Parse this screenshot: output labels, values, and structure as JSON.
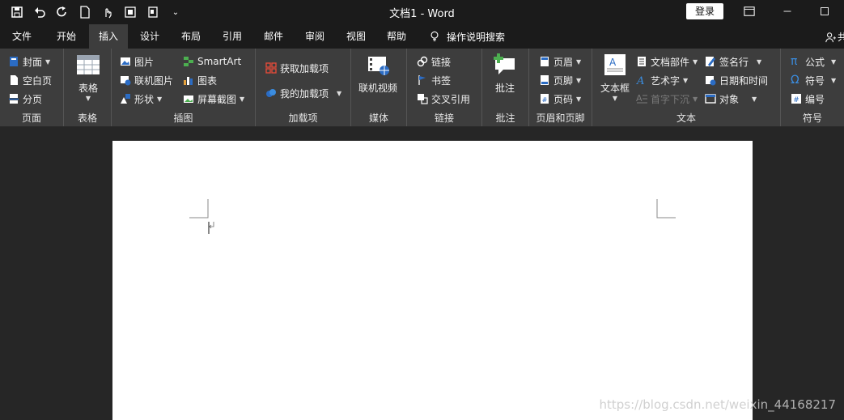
{
  "window": {
    "title": "文档1  -  Word",
    "login_label": "登录"
  },
  "tabs": [
    "文件",
    "开始",
    "插入",
    "设计",
    "布局",
    "引用",
    "邮件",
    "审阅",
    "视图",
    "帮助"
  ],
  "tell_me": "操作说明搜索",
  "user_glyph": "共",
  "ribbon": {
    "page": {
      "label": "页面",
      "items": [
        "封面",
        "空白页",
        "分页"
      ]
    },
    "table": {
      "label": "表格",
      "item": "表格"
    },
    "illustrations": {
      "label": "插图",
      "items": [
        "图片",
        "联机图片",
        "形状",
        "SmartArt",
        "图表",
        "屏幕截图"
      ]
    },
    "addins": {
      "label": "加载项",
      "items": [
        "获取加载项",
        "我的加载项"
      ]
    },
    "media": {
      "label": "媒体",
      "item": "联机视频"
    },
    "links": {
      "label": "链接",
      "items": [
        "链接",
        "书签",
        "交叉引用"
      ]
    },
    "comments": {
      "label": "批注",
      "item": "批注"
    },
    "header_footer": {
      "label": "页眉和页脚",
      "items": [
        "页眉",
        "页脚",
        "页码"
      ]
    },
    "text": {
      "label": "文本",
      "textbox": "文本框",
      "items": [
        "文档部件",
        "艺术字",
        "首字下沉",
        "签名行",
        "日期和时间",
        "对象"
      ]
    },
    "symbols": {
      "label": "符号",
      "items": [
        "公式",
        "符号",
        "编号"
      ]
    }
  },
  "watermark": "https://blog.csdn.net/weixin_44168217",
  "colors": {
    "accent": "#2b6cc4",
    "ribbon_bg": "#3d3d3d",
    "title_bg": "#1b1b1b",
    "canvas_bg": "#262626"
  }
}
